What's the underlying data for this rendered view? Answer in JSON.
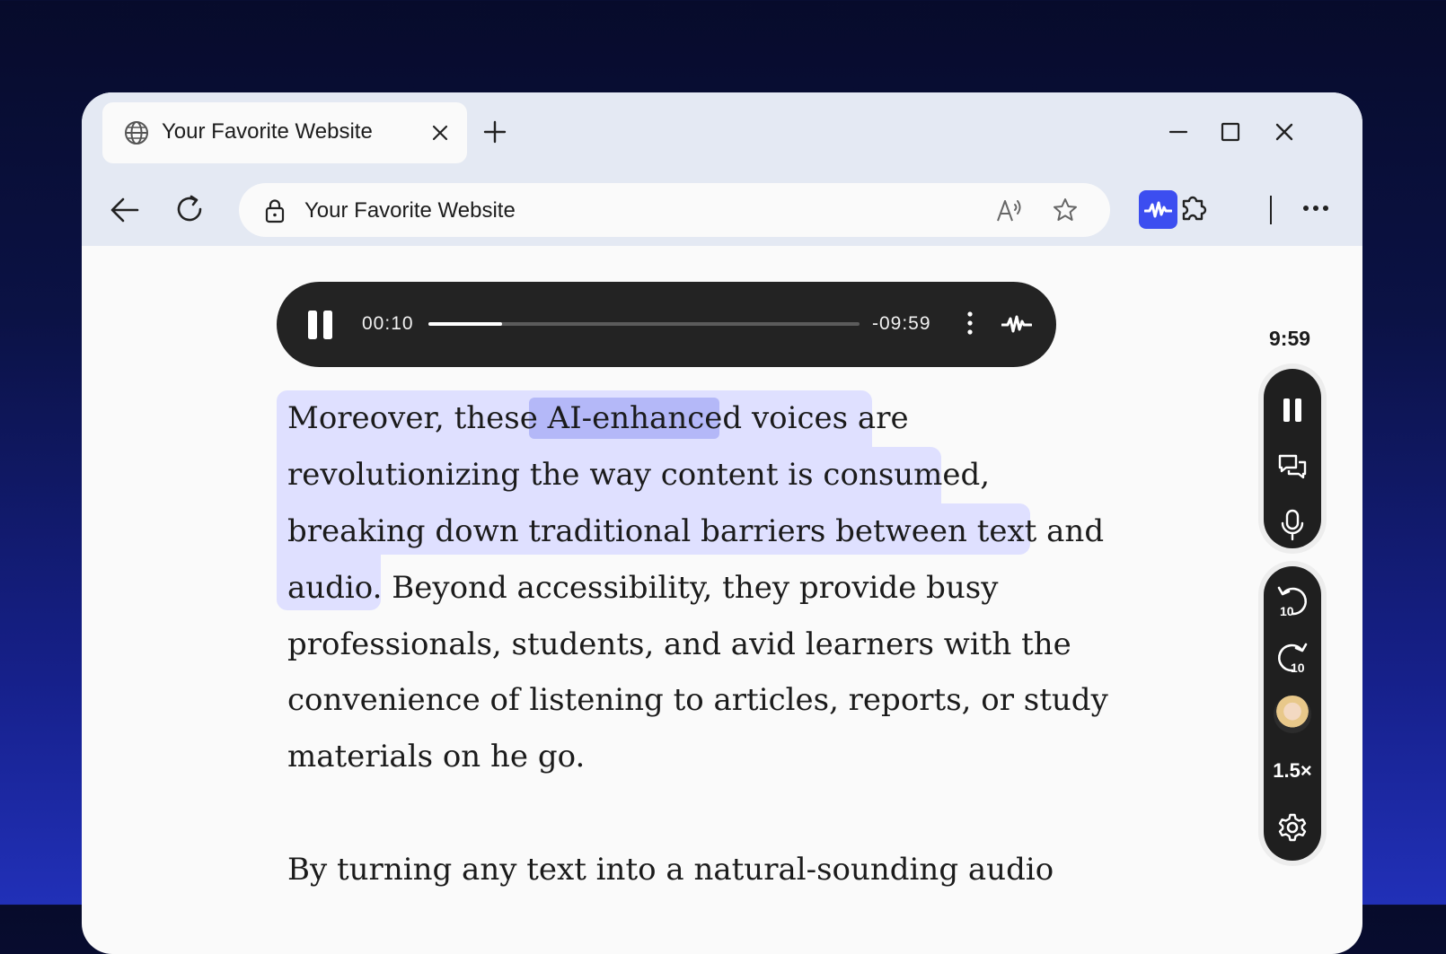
{
  "browser": {
    "tab_title": "Your Favorite Website",
    "url_text": "Your Favorite Website"
  },
  "player": {
    "elapsed": "00:10",
    "remaining": "-09:59",
    "progress_fraction": 0.17
  },
  "article": {
    "paragraph1": [
      "Moreover, these ",
      "AI-enhanced",
      " voices are",
      "revolutionizing the way content is consumed,",
      "breaking down traditional barriers between text and",
      "audio.",
      " Beyond accessibility, they provide busy",
      "professionals, students, and avid learners with the",
      "convenience of listening to articles, reports, or study",
      "materials on he go."
    ],
    "paragraph2_line1": "By turning any text into a natural-sounding audio"
  },
  "side_controls": {
    "time": "9:59",
    "speed": "1.5×"
  },
  "colors": {
    "accent": "#3c4ef0",
    "sentence_highlight": "#dfe0ff",
    "word_highlight": "#b4b8f8",
    "player_bg": "#232323"
  }
}
